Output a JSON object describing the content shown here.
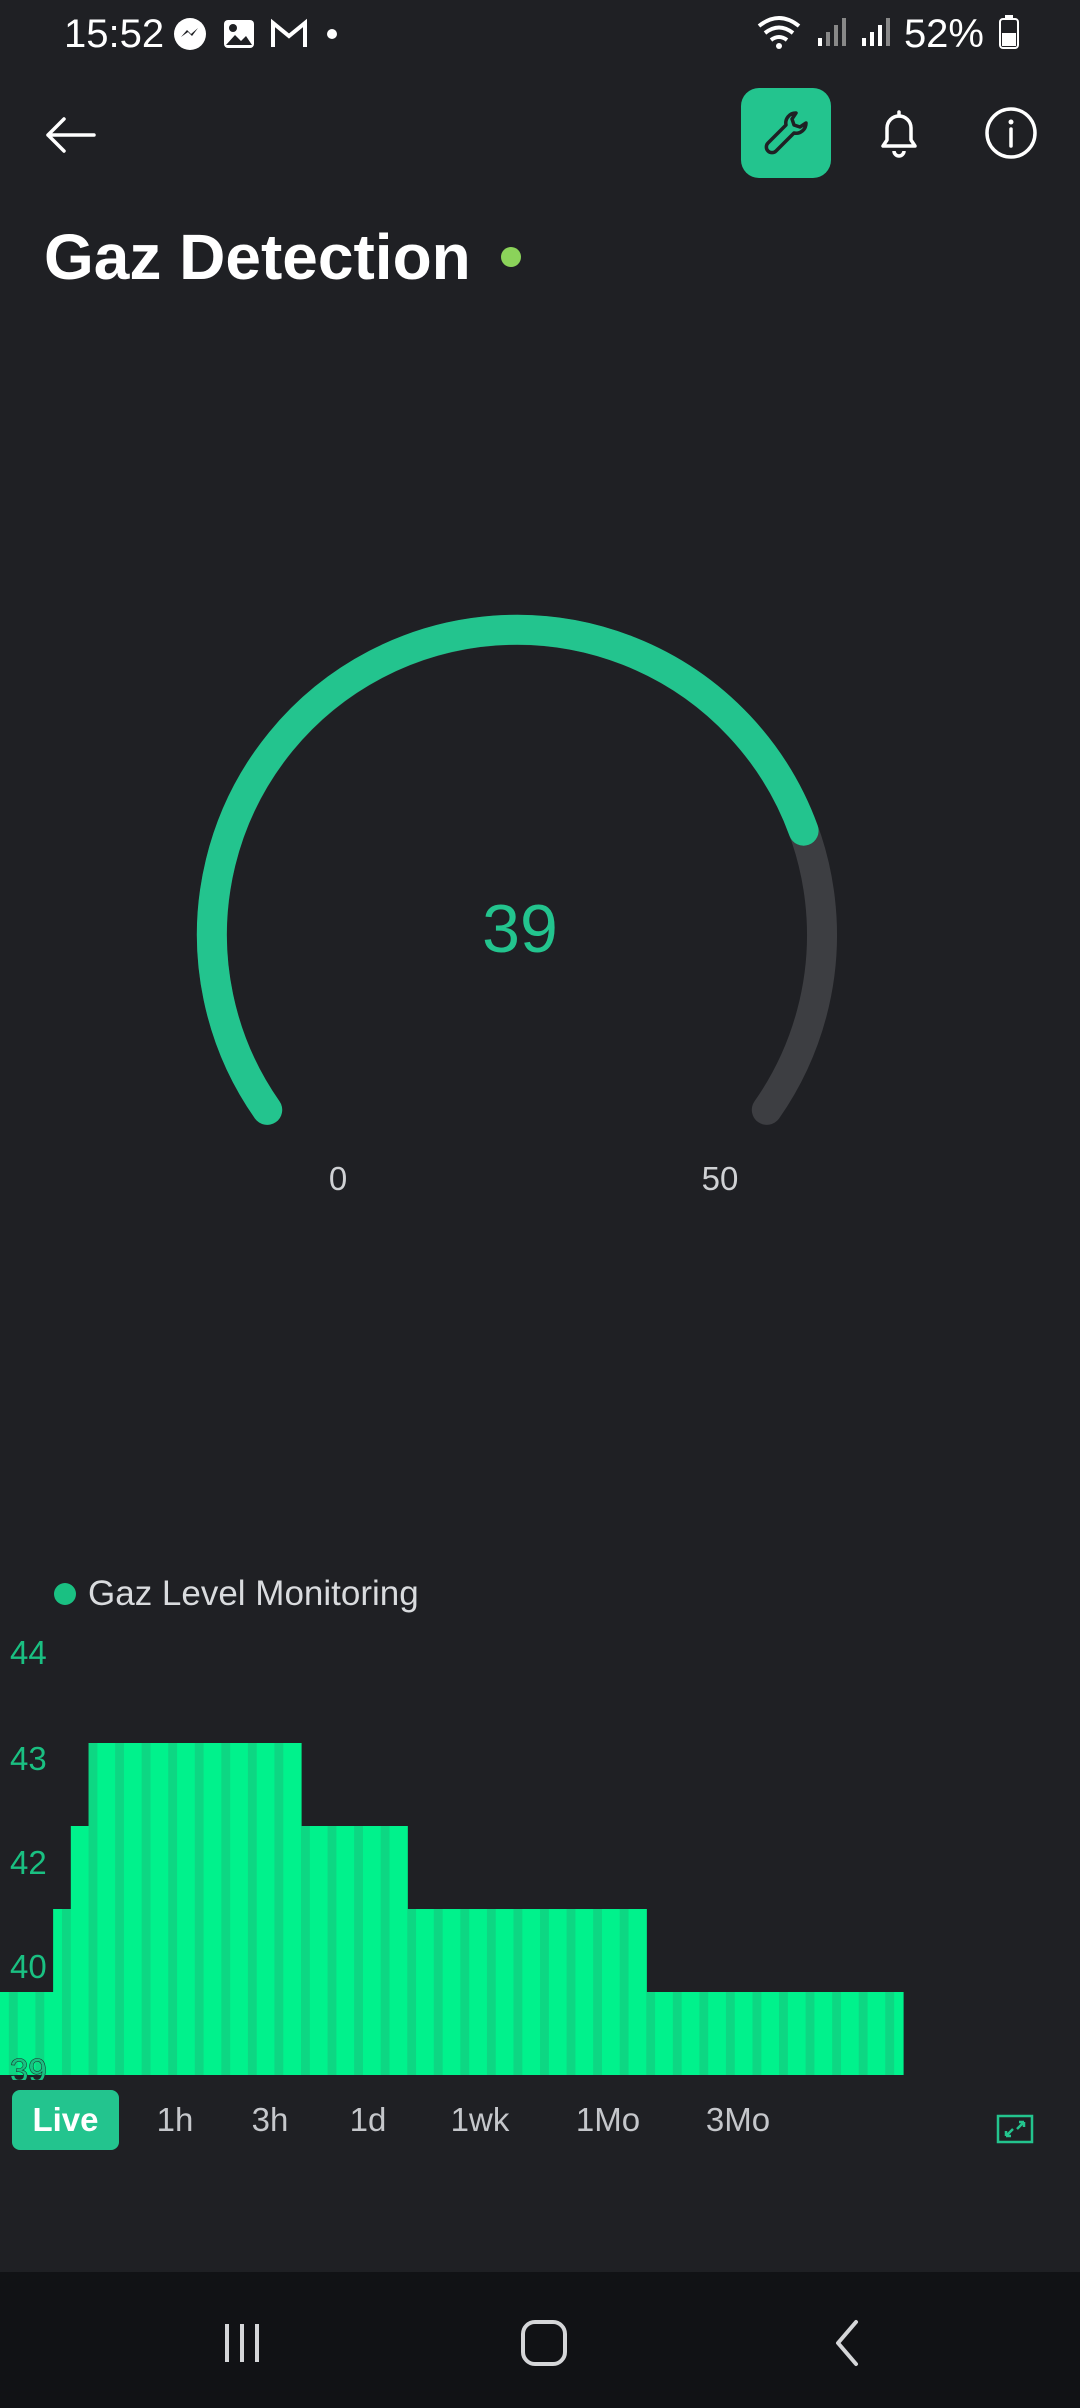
{
  "status": {
    "time": "15:52",
    "battery": "52%",
    "left_icons": [
      "messenger-icon",
      "gallery-icon",
      "gmail-icon",
      "dot-icon"
    ],
    "right_icons": [
      "wifi-icon",
      "signal-icon",
      "signal-icon",
      "battery-icon"
    ]
  },
  "header": {
    "title": "Gaz Detection",
    "status_color": "#8bd35a",
    "accent": "#23c48e"
  },
  "gauge": {
    "value": "39",
    "min": "0",
    "max": "50",
    "fill_fraction": 0.78
  },
  "chart_legend": "Gaz Level Monitoring",
  "chart_data": {
    "type": "bar",
    "series": [
      {
        "name": "Gaz Level Monitoring",
        "color": "#00f28c"
      }
    ],
    "yticks": [
      "44",
      "43",
      "42",
      "40",
      "39"
    ],
    "ylim": [
      39,
      44
    ],
    "x": [
      0,
      1,
      2,
      3,
      4,
      5,
      6,
      7,
      8,
      9,
      10,
      11,
      12,
      13,
      14,
      15,
      16,
      17,
      18,
      19,
      20,
      21,
      22,
      23,
      24,
      25,
      26,
      27,
      28,
      29,
      30,
      31,
      32,
      33,
      34,
      35,
      36,
      37,
      38,
      39,
      40,
      41,
      42,
      43,
      44,
      45,
      46,
      47,
      48,
      49,
      50,
      51,
      52,
      53,
      54,
      55,
      56,
      57,
      58,
      59,
      60,
      61,
      62,
      63,
      64,
      65,
      66,
      67,
      68,
      69,
      70,
      71,
      72,
      73,
      74,
      75,
      76,
      77,
      78,
      79,
      80,
      81,
      82,
      83,
      84,
      85,
      86,
      87,
      88,
      89,
      90,
      91,
      92,
      93,
      94,
      95,
      96,
      97,
      98,
      99,
      100,
      101
    ],
    "values": [
      40,
      40,
      40,
      40,
      40,
      40,
      41,
      41,
      42,
      42,
      43,
      43,
      43,
      43,
      43,
      43,
      43,
      43,
      43,
      43,
      43,
      43,
      43,
      43,
      43,
      43,
      43,
      43,
      43,
      43,
      43,
      43,
      43,
      43,
      42,
      42,
      42,
      42,
      42,
      42,
      42,
      42,
      42,
      42,
      42,
      42,
      41,
      41,
      41,
      41,
      41,
      41,
      41,
      41,
      41,
      41,
      41,
      41,
      41,
      41,
      41,
      41,
      41,
      41,
      41,
      41,
      41,
      41,
      41,
      41,
      41,
      41,
      41,
      40,
      40,
      40,
      40,
      40,
      40,
      40,
      40,
      40,
      40,
      40,
      40,
      40,
      40,
      40,
      40,
      40,
      40,
      40,
      40,
      40,
      40,
      40,
      40,
      40,
      40,
      40,
      40,
      40
    ]
  },
  "ranges": [
    {
      "label": "Live",
      "active": true
    },
    {
      "label": "1h",
      "active": false
    },
    {
      "label": "3h",
      "active": false
    },
    {
      "label": "1d",
      "active": false
    },
    {
      "label": "1wk",
      "active": false
    },
    {
      "label": "1Mo",
      "active": false
    },
    {
      "label": "3Mo",
      "active": false
    }
  ]
}
